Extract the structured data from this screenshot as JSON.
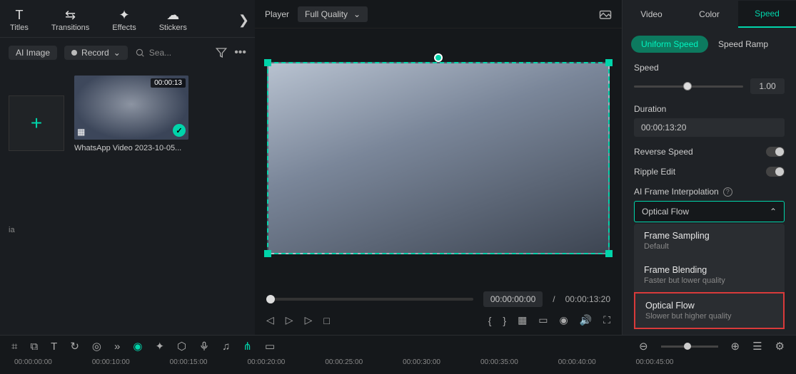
{
  "tabs": {
    "titles": "Titles",
    "transitions": "Transitions",
    "effects": "Effects",
    "stickers": "Stickers"
  },
  "toolbar": {
    "ai_image": "AI Image",
    "record": "Record",
    "search_placeholder": "Sea..."
  },
  "ai_label": "ia",
  "clip": {
    "duration": "00:00:13",
    "name": "WhatsApp Video 2023-10-05..."
  },
  "player": {
    "label": "Player",
    "quality": "Full Quality",
    "current": "00:00:00:00",
    "total": "00:00:13:20",
    "sep": "/"
  },
  "right_tabs": {
    "video": "Video",
    "color": "Color",
    "speed": "Speed"
  },
  "speed": {
    "uniform": "Uniform Speed",
    "ramp": "Speed Ramp",
    "speed_label": "Speed",
    "speed_value": "1.00",
    "duration_label": "Duration",
    "duration_value": "00:00:13:20",
    "reverse": "Reverse Speed",
    "ripple": "Ripple Edit",
    "interp_label": "AI Frame Interpolation",
    "interp_value": "Optical Flow",
    "options": [
      {
        "title": "Frame Sampling",
        "sub": "Default"
      },
      {
        "title": "Frame Blending",
        "sub": "Faster but lower quality"
      },
      {
        "title": "Optical Flow",
        "sub": "Slower but higher quality"
      }
    ]
  },
  "timeline": {
    "codes": [
      "00:00:00:00",
      "00:00:10:00",
      "00:00:15:00",
      "00:00:20:00",
      "00:00:25:00",
      "00:00:30:00",
      "00:00:35:00",
      "00:00:40:00",
      "00:00:45:00"
    ]
  }
}
